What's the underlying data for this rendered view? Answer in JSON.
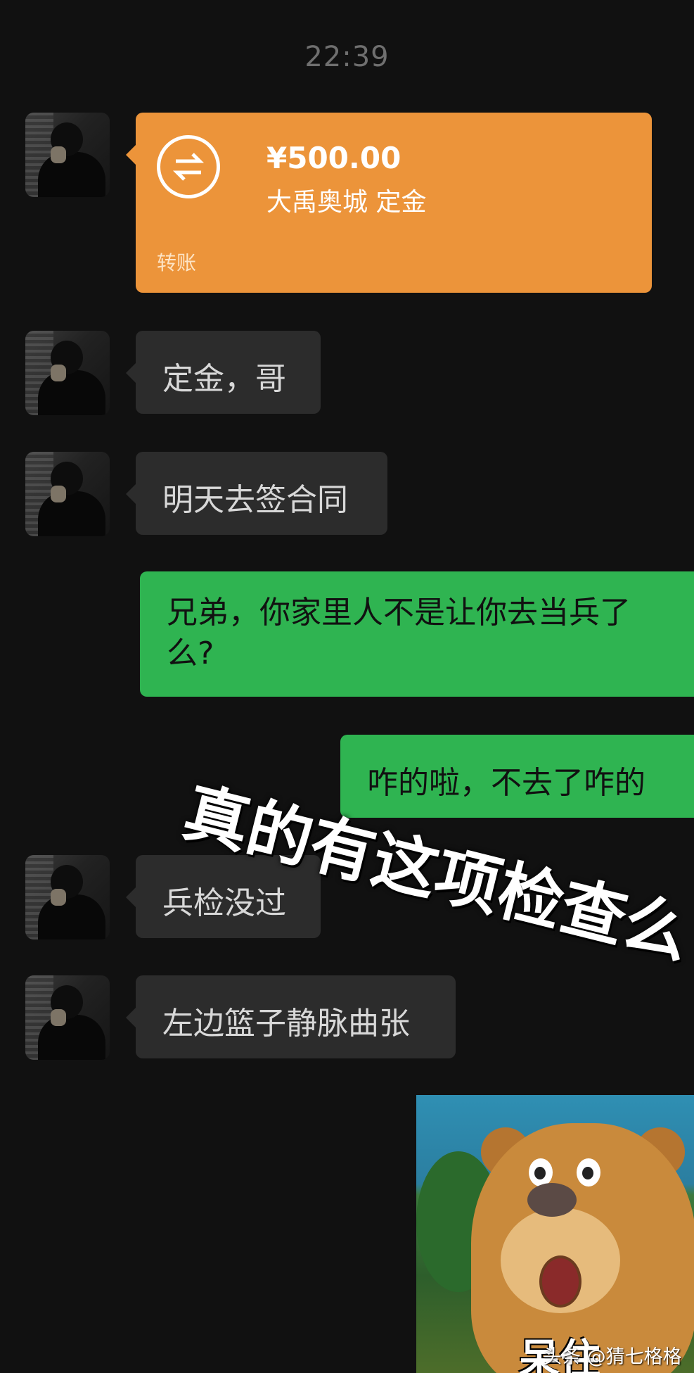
{
  "status": {
    "time": "22:39"
  },
  "messages": [
    {
      "type": "transfer",
      "amount": "¥500.00",
      "memo": "大禹奥城 定金",
      "label": "转账"
    },
    {
      "type": "text",
      "side": "received",
      "text": "定金，哥"
    },
    {
      "type": "text",
      "side": "received",
      "text": "明天去签合同"
    },
    {
      "type": "text",
      "side": "sent",
      "lines": [
        "兄弟，你家里人不是让你去当兵了",
        "么?"
      ]
    },
    {
      "type": "text",
      "side": "sent",
      "text": "咋的啦，不去了咋的"
    },
    {
      "type": "text",
      "side": "received",
      "text": "兵检没过"
    },
    {
      "type": "text",
      "side": "received",
      "text": "左边篮子静脉曲张"
    }
  ],
  "overlay_caption": "真的有这项检查么",
  "sticker": {
    "caption": "呆住",
    "icon": "bear-sticker"
  },
  "watermark": "头条 @猜七格格",
  "colors": {
    "background": "#111111",
    "received": "#2c2c2c",
    "sent": "#2fb451",
    "transfer": "#ec943a"
  }
}
